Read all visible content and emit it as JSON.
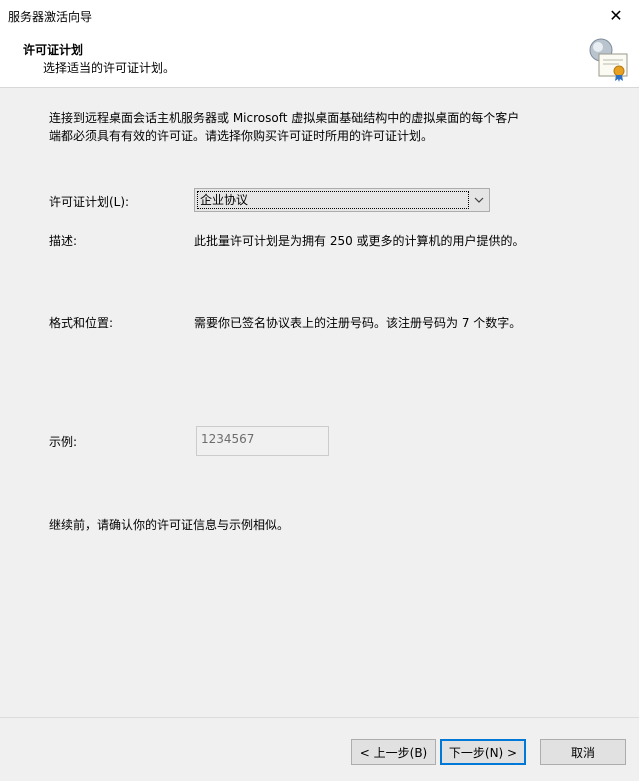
{
  "window": {
    "title": "服务器激活向导",
    "close_glyph": "✕"
  },
  "header": {
    "title": "许可证计划",
    "subtitle": "选择适当的许可证计划。",
    "icon": "certificate-icon"
  },
  "intro": {
    "line1": "连接到远程桌面会话主机服务器或 Microsoft 虚拟桌面基础结构中的虚拟桌面的每个客户",
    "line2": "端都必须具有有效的许可证。请选择你购买许可证时所用的许可证计划。"
  },
  "form": {
    "license_label": "许可证计划(L):",
    "license_selected": "企业协议",
    "desc_label": "描述:",
    "desc_value": "此批量许可计划是为拥有 250 或更多的计算机的用户提供的。",
    "format_label": "格式和位置:",
    "format_value": "需要你已签名协议表上的注册号码。该注册号码为 7 个数字。",
    "example_label": "示例:",
    "example_value": "1234567",
    "confirm_text": "继续前，请确认你的许可证信息与示例相似。"
  },
  "buttons": {
    "back": "< 上一步(B)",
    "next": "下一步(N) >",
    "cancel": "取消"
  },
  "colors": {
    "default_button_border": "#0078d7",
    "dialog_background": "#f0f0f0",
    "header_background": "#ffffff"
  }
}
